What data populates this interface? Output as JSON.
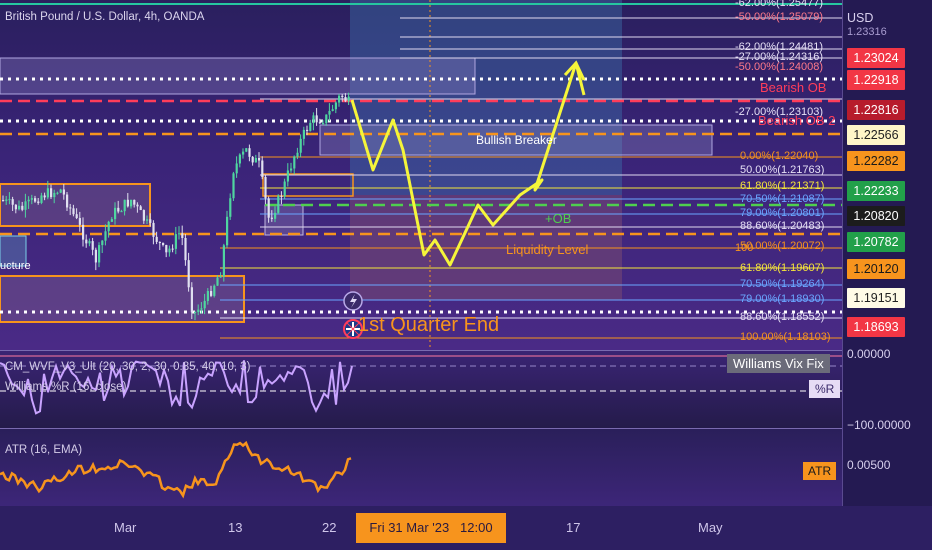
{
  "header": {
    "symbol_title": "British Pound / U.S. Dollar, 4h, OANDA"
  },
  "colors": {
    "orange": "#f7941d",
    "red": "#ff3d5a",
    "yellow": "#f5f53a",
    "green": "#4fcf4f",
    "white": "#ffffff"
  },
  "price_axis": {
    "currency": "USD",
    "top_partial": "1.23316",
    "tags": [
      {
        "value": "1.23024",
        "bg": "#f23645",
        "fg": "#ffffff"
      },
      {
        "value": "1.22918",
        "bg": "#f23645",
        "fg": "#ffffff"
      },
      {
        "value": "1.22816",
        "bg": "#b71c2c",
        "fg": "#ffffff"
      },
      {
        "value": "1.22566",
        "bg": "#fff6c8",
        "fg": "#222222"
      },
      {
        "value": "1.22282",
        "bg": "#f7941d",
        "fg": "#1a1a1a"
      },
      {
        "value": "1.22233",
        "bg": "#22a04a",
        "fg": "#ffffff"
      },
      {
        "value": "1.20820",
        "bg": "#1c1c1c",
        "fg": "#ffffff"
      },
      {
        "value": "1.20782",
        "bg": "#22a04a",
        "fg": "#ffffff"
      },
      {
        "value": "1.20120",
        "bg": "#f7941d",
        "fg": "#1a1a1a"
      },
      {
        "value": "1.19151",
        "bg": "#fffbe6",
        "fg": "#222222"
      },
      {
        "value": "1.18693",
        "bg": "#f23645",
        "fg": "#ffffff"
      }
    ],
    "osc_top": "0.00000",
    "osc_bottom": "−100.00000",
    "atr_value": "0.00500"
  },
  "fib_labels": [
    {
      "text": "-62.00%(1.25477)",
      "color": "#e6e0f5"
    },
    {
      "text": "-50.00%(1.25079)",
      "color": "#ff7a8a"
    },
    {
      "text": "-62.00%(1.24481)",
      "color": "#e6e0f5"
    },
    {
      "text": "-27.00%(1.24316)",
      "color": "#e6e0f5"
    },
    {
      "text": "-50.00%(1.24008)",
      "color": "#ff7a8a"
    },
    {
      "text": "-27.00%(1.23103)",
      "color": "#e6e0f5"
    },
    {
      "text": "0.00%(1.22040)",
      "color": "#f7941d"
    },
    {
      "text": "50.00%(1.21763)",
      "color": "#e6e0f5"
    },
    {
      "text": "61.80%(1.21371)",
      "color": "#f5e53a"
    },
    {
      "text": "70.50%(1.21087)",
      "color": "#6aa6ff"
    },
    {
      "text": "79.00%(1.20801)",
      "color": "#6aa6ff"
    },
    {
      "text": "88.60%(1.20483)",
      "color": "#e6e0f5"
    },
    {
      "text": "50.00%(1.20072)",
      "color": "#f7941d"
    },
    {
      "text": "61.80%(1.19607)",
      "color": "#f5e53a"
    },
    {
      "text": "70.50%(1.19264)",
      "color": "#6aa6ff"
    },
    {
      "text": "79.00%(1.18930)",
      "color": "#6aa6ff"
    },
    {
      "text": "88.60%(1.18552)",
      "color": "#e6e0f5"
    },
    {
      "text": "100.00%(1.18103)",
      "color": "#f7941d"
    }
  ],
  "labels": {
    "bearish_ob": "Bearish OB",
    "bearish_ob2": "Bearish OB 2",
    "bullish_breaker": "Bullish Breaker",
    "plus_ob": "+OB",
    "liquidity": "Liquidity Level",
    "quarter_end": "1st Quarter End",
    "structure": "ucture",
    "fib_partial": "100"
  },
  "indicators": {
    "wvf_legend": "CM_WVF_V3_Ult (20, 30, 2, 30, 0.85, 40, 10, 3)",
    "wr_legend": "Williams %R (16, close)",
    "wvf_tag": "Williams Vix Fix",
    "wr_tag": "%R",
    "atr_legend": "ATR (16, EMA)",
    "atr_tag": "ATR"
  },
  "time_axis": {
    "labels": [
      "Mar",
      "13",
      "22",
      "17",
      "May"
    ],
    "crosshair": "Fri 31 Mar '23   12:00"
  }
}
